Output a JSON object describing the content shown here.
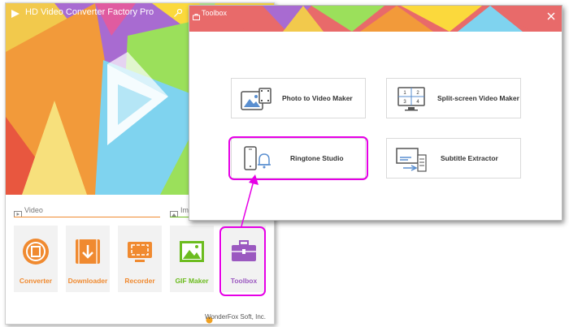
{
  "main_window": {
    "title": "HD Video Converter Factory Pro",
    "sections": {
      "video_label": "Video",
      "image_label": "Ima"
    },
    "tiles": [
      {
        "label": "Converter",
        "icon": "film-reel-icon",
        "color": "#f08a30"
      },
      {
        "label": "Downloader",
        "icon": "download-arrow-icon",
        "color": "#f08a30"
      },
      {
        "label": "Recorder",
        "icon": "screen-record-icon",
        "color": "#f08a30"
      },
      {
        "label": "GIF Maker",
        "icon": "landscape-picture-icon",
        "color": "#6cbc1f"
      },
      {
        "label": "Toolbox",
        "icon": "toolbox-icon",
        "color": "#9b59c0"
      }
    ],
    "footer": "WonderFox Soft, Inc."
  },
  "toolbox_window": {
    "title": "Toolbox",
    "tools": [
      {
        "label": "Photo to Video Maker",
        "icon": "photo-to-video-icon"
      },
      {
        "label": "Split-screen Video Maker",
        "icon": "split-screen-icon",
        "grid_numbers": [
          "1",
          "2",
          "3",
          "4"
        ]
      },
      {
        "label": "Ringtone Studio",
        "icon": "phone-bell-icon"
      },
      {
        "label": "Subtitle Extractor",
        "icon": "subtitle-extract-icon"
      }
    ]
  },
  "colors": {
    "highlight": "#e600e6",
    "accent_orange": "#f08a30",
    "accent_green": "#6cbc1f",
    "accent_purple": "#9b59c0"
  }
}
